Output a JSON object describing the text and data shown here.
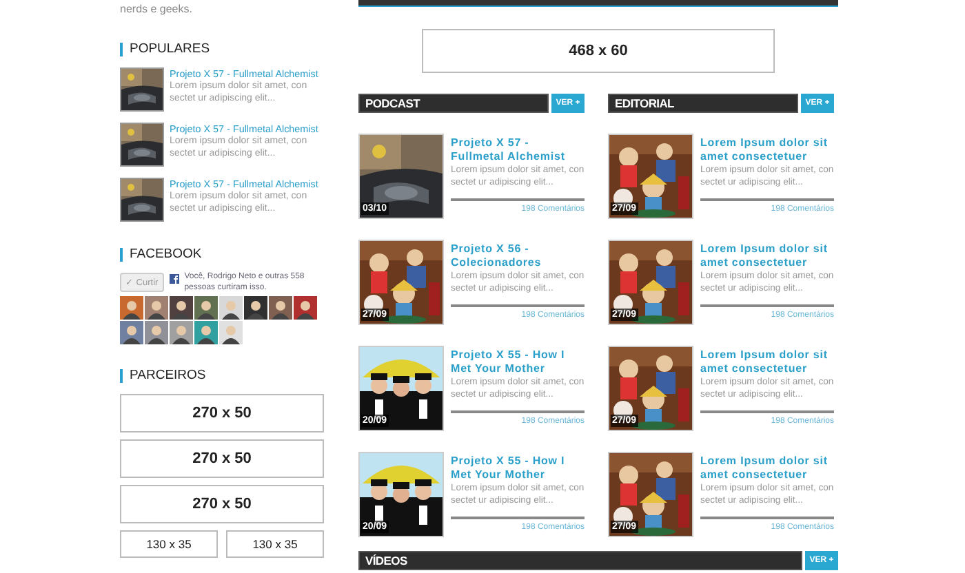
{
  "sidebar": {
    "intro": "nerds e geeks.",
    "popular": {
      "title": "POPULARES",
      "items": [
        {
          "title": "Projeto X 57 - Fullmetal Alchemist",
          "excerpt": "Lorem ipsum dolor sit amet, con sectet ur adipiscing elit..."
        },
        {
          "title": "Projeto X 57 - Fullmetal Alchemist",
          "excerpt": "Lorem ipsum dolor sit amet, con sectet ur adipiscing elit..."
        },
        {
          "title": "Projeto X 57 - Fullmetal Alchemist",
          "excerpt": "Lorem ipsum dolor sit amet, con sectet ur adipiscing elit..."
        }
      ]
    },
    "facebook": {
      "title": "FACEBOOK",
      "like_button": "✓ Curtir",
      "like_text": "Você, Rodrigo Neto e outras 558 pessoas curtiram isso."
    },
    "partners": {
      "title": "PARCEIROS",
      "ads": [
        {
          "label": "270 x 50",
          "kind": "wide"
        },
        {
          "label": "270 x 50",
          "kind": "wide"
        },
        {
          "label": "270 x 50",
          "kind": "wide"
        },
        {
          "label": "130 x 35",
          "kind": "small"
        },
        {
          "label": "130 x 35",
          "kind": "small"
        }
      ]
    }
  },
  "banner": "468 x 60",
  "sections": [
    {
      "title": "PODCAST",
      "more": "VER +",
      "posts": [
        {
          "title": "Projeto X 57 - Fullmetal Alchemist",
          "excerpt": "Lorem ipsum dolor sit amet, con sectet ur adipiscing elit...",
          "date": "03/10",
          "comments": "198 Comentários"
        },
        {
          "title": "Projeto X 56 - Colecionadores",
          "excerpt": "Lorem ipsum dolor sit amet, con sectet ur adipiscing elit...",
          "date": "27/09",
          "comments": "198 Comentários"
        },
        {
          "title": "Projeto X 55 - How I Met Your Mother",
          "excerpt": "Lorem ipsum dolor sit amet, con sectet ur adipiscing elit...",
          "date": "20/09",
          "comments": "198 Comentários"
        },
        {
          "title": "Projeto X 55 - How I Met Your Mother",
          "excerpt": "Lorem ipsum dolor sit amet, con sectet ur adipiscing elit...",
          "date": "20/09",
          "comments": "198 Comentários"
        }
      ]
    },
    {
      "title": "EDITORIAL",
      "more": "VER +",
      "posts": [
        {
          "title": "Lorem Ipsum dolor sit amet consectetuer",
          "excerpt": "Lorem ipsum dolor sit amet, con sectet ur adipiscing elit...",
          "date": "27/09",
          "comments": "198 Comentários"
        },
        {
          "title": "Lorem Ipsum dolor sit amet consectetuer",
          "excerpt": "Lorem ipsum dolor sit amet, con sectet ur adipiscing elit...",
          "date": "27/09",
          "comments": "198 Comentários"
        },
        {
          "title": "Lorem Ipsum dolor sit amet consectetuer",
          "excerpt": "Lorem ipsum dolor sit amet, con sectet ur adipiscing elit...",
          "date": "27/09",
          "comments": "198 Comentários"
        },
        {
          "title": "Lorem Ipsum dolor sit amet consectetuer",
          "excerpt": "Lorem ipsum dolor sit amet, con sectet ur adipiscing elit...",
          "date": "27/09",
          "comments": "198 Comentários"
        }
      ]
    }
  ],
  "videos": {
    "title": "VÍDEOS",
    "more": "VER +"
  }
}
